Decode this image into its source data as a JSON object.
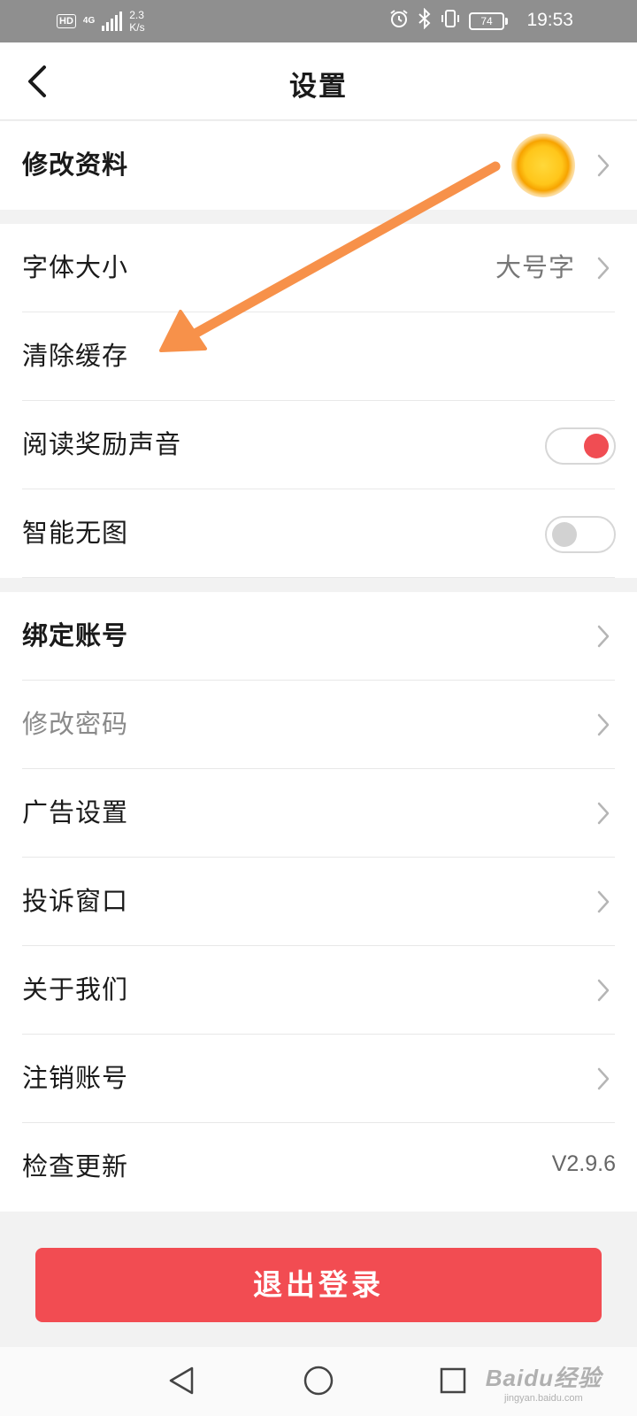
{
  "status_bar": {
    "hd": "HD",
    "network": "4G",
    "speed_value": "2.3",
    "speed_unit": "K/s",
    "battery": "74",
    "time": "19:53"
  },
  "header": {
    "title": "设置",
    "back_icon": "chevron-left-icon"
  },
  "profile": {
    "label": "修改资料",
    "avatar": "sun-avatar"
  },
  "preferences": [
    {
      "label": "字体大小",
      "value": "大号字"
    },
    {
      "label": "清除缓存"
    },
    {
      "label": "阅读奖励声音",
      "toggle": "on"
    },
    {
      "label": "智能无图",
      "toggle": "off"
    }
  ],
  "account": [
    {
      "label": "绑定账号"
    },
    {
      "label": "修改密码"
    },
    {
      "label": "广告设置"
    },
    {
      "label": "投诉窗口"
    },
    {
      "label": "关于我们"
    },
    {
      "label": "注销账号"
    },
    {
      "label": "检查更新",
      "value": "V2.9.6"
    }
  ],
  "logout_label": "退出登录",
  "watermark": {
    "logo": "Baidu经验",
    "url": "jingyan.baidu.com"
  },
  "colors": {
    "accent": "#f24c52",
    "annotation_arrow": "#f7914a",
    "background": "#f2f2f2"
  }
}
